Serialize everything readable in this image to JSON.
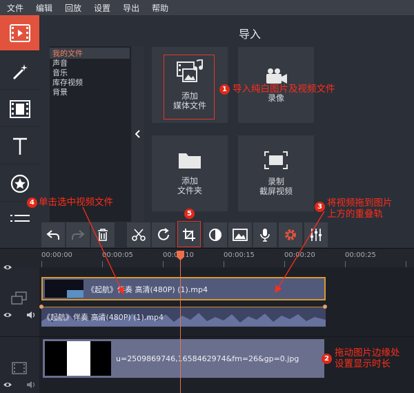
{
  "menu": [
    "文件",
    "编辑",
    "回放",
    "设置",
    "导出",
    "帮助"
  ],
  "import_title": "导入",
  "file_list": [
    "我的文件",
    "声音",
    "音乐",
    "库存视频",
    "背景"
  ],
  "tiles": {
    "media": {
      "line1": "添加",
      "line2": "媒体文件"
    },
    "record": {
      "line1": "录像",
      "line2": ""
    },
    "folder": {
      "line1": "添加",
      "line2": "文件夹"
    },
    "screen": {
      "line1": "录制",
      "line2": "截屏视频"
    }
  },
  "annotations": {
    "a1": {
      "num": "1",
      "text": "导入纯白图片及视频文件"
    },
    "a2": {
      "num": "2",
      "line1": "拖动图片边缘处",
      "line2": "设置显示时长"
    },
    "a3": {
      "num": "3",
      "line1": "将视频拖到图片",
      "line2": "上方的重叠轨"
    },
    "a4": {
      "num": "4",
      "text": "单击选中视频文件"
    },
    "a5": {
      "num": "5"
    }
  },
  "timeline": {
    "ticks": [
      "00:00:00",
      "00:00:05",
      "00:00:10",
      "00:00:15",
      "00:00:20",
      "00:00:25"
    ],
    "video_clip_title": "《起航》伴奏 高清(480P) (1).mp4",
    "audio_clip_title": "《起航》伴奏 高清(480P) (1).mp4",
    "image_clip_title": "u=2509869746,1658462974&fm=26&gp=0.jpg"
  },
  "colors": {
    "accent": "#e2533d",
    "annotation": "#ff2d1a",
    "clip_border": "#d69a33"
  }
}
